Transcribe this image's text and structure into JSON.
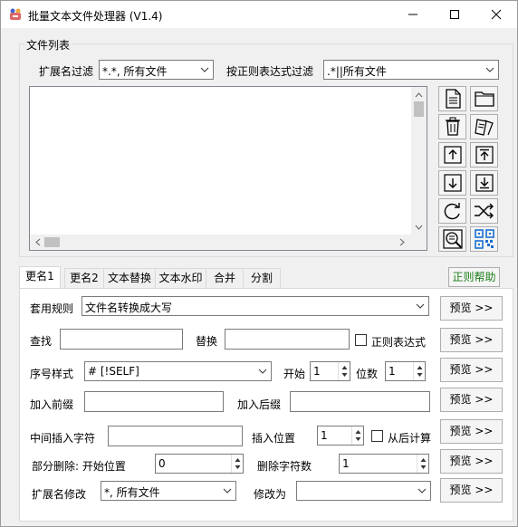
{
  "window": {
    "title": "批量文本文件处理器  (V1.4)"
  },
  "filelist": {
    "group_label": "文件列表",
    "ext_filter_label": "扩展名过滤",
    "ext_filter_value": "*.*, 所有文件",
    "regex_filter_label": "按正则表达式过滤",
    "regex_filter_value": ".*||所有文件"
  },
  "tabs": [
    {
      "label": "更名1"
    },
    {
      "label": "更名2"
    },
    {
      "label": "文本替换"
    },
    {
      "label": "文本水印"
    },
    {
      "label": "合并"
    },
    {
      "label": "分割"
    }
  ],
  "help_label": "正则帮助",
  "rename": {
    "rule_label": "套用规则",
    "rule_value": "文件名转换成大写",
    "find_label": "查找",
    "replace_label": "替换",
    "regex_check_label": "正则表达式",
    "seq_label": "序号样式",
    "seq_value": "# [!SELF]",
    "start_label": "开始",
    "start_value": "1",
    "digits_label": "位数",
    "digits_value": "1",
    "prefix_label": "加入前缀",
    "suffix_label": "加入后缀",
    "insert_label": "中间插入字符",
    "insert_pos_label": "插入位置",
    "insert_pos_value": "1",
    "from_end_label": "从后计算",
    "partdel_label": "部分删除: 开始位置",
    "partdel_start_value": "0",
    "delcount_label": "删除字符数",
    "delcount_value": "1",
    "extmod_label": "扩展名修改",
    "extmod_value": "*, 所有文件",
    "modto_label": "修改为",
    "preview_label": "预览 >>"
  }
}
